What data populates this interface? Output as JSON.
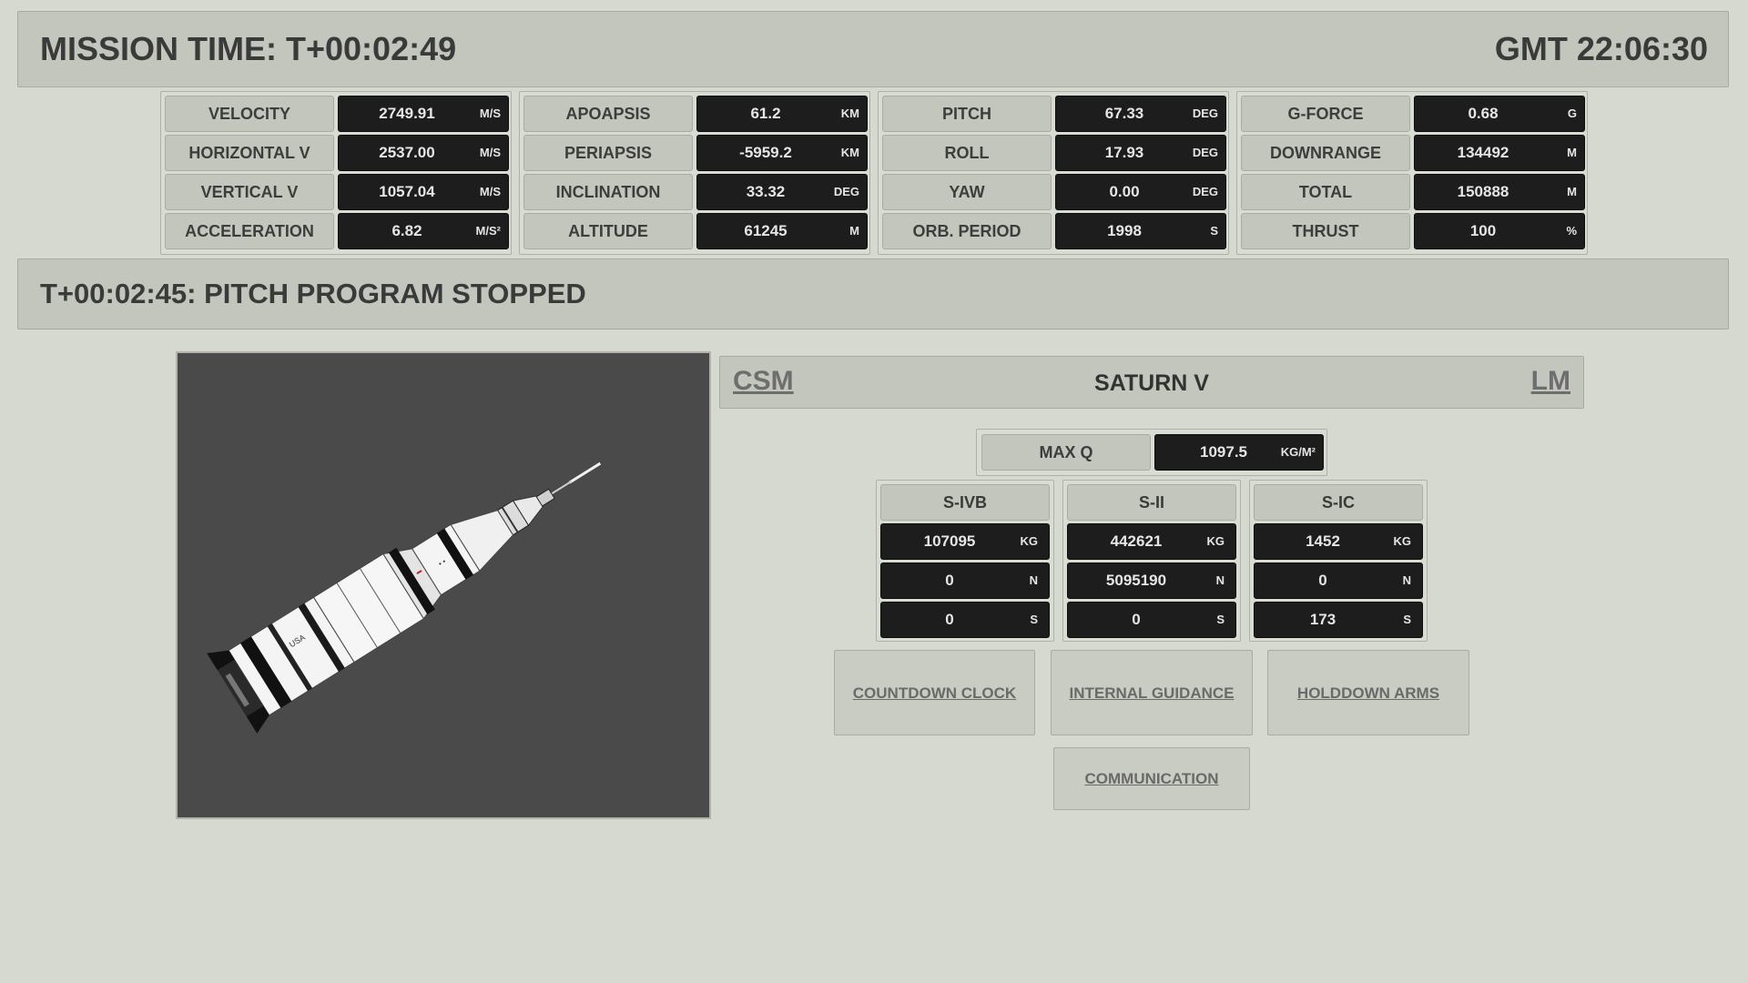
{
  "header": {
    "mission_time": "MISSION TIME: T+00:02:49",
    "gmt": "GMT 22:06:30"
  },
  "telemetry": [
    {
      "label": "VELOCITY",
      "value": "2749.91",
      "unit": "M/S"
    },
    {
      "label": "HORIZONTAL V",
      "value": "2537.00",
      "unit": "M/S"
    },
    {
      "label": "VERTICAL V",
      "value": "1057.04",
      "unit": "M/S"
    },
    {
      "label": "ACCELERATION",
      "value": "6.82",
      "unit": "M/S²"
    },
    {
      "label": "APOAPSIS",
      "value": "61.2",
      "unit": "KM"
    },
    {
      "label": "PERIAPSIS",
      "value": "-5959.2",
      "unit": "KM"
    },
    {
      "label": "INCLINATION",
      "value": "33.32",
      "unit": "DEG"
    },
    {
      "label": "ALTITUDE",
      "value": "61245",
      "unit": "M"
    },
    {
      "label": "PITCH",
      "value": "67.33",
      "unit": "DEG"
    },
    {
      "label": "ROLL",
      "value": "17.93",
      "unit": "DEG"
    },
    {
      "label": "YAW",
      "value": "0.00",
      "unit": "DEG"
    },
    {
      "label": "ORB. PERIOD",
      "value": "1998",
      "unit": "S"
    },
    {
      "label": "G-FORCE",
      "value": "0.68",
      "unit": "G"
    },
    {
      "label": "DOWNRANGE",
      "value": "134492",
      "unit": "M"
    },
    {
      "label": "TOTAL",
      "value": "150888",
      "unit": "M"
    },
    {
      "label": "THRUST",
      "value": "100",
      "unit": "%"
    }
  ],
  "event": {
    "text": "T+00:02:45: PITCH PROGRAM STOPPED"
  },
  "vehicle": {
    "csm_link": "CSM",
    "name": "SATURN V",
    "lm_link": "LM"
  },
  "max_q": {
    "label": "MAX Q",
    "value": "1097.5",
    "unit": "KG/M²"
  },
  "stages": [
    {
      "name": "S-IVB",
      "mass": "107095",
      "mass_unit": "KG",
      "thrust": "0",
      "thrust_unit": "N",
      "time": "0",
      "time_unit": "S"
    },
    {
      "name": "S-II",
      "mass": "442621",
      "mass_unit": "KG",
      "thrust": "5095190",
      "thrust_unit": "N",
      "time": "0",
      "time_unit": "S"
    },
    {
      "name": "S-IC",
      "mass": "1452",
      "mass_unit": "KG",
      "thrust": "0",
      "thrust_unit": "N",
      "time": "173",
      "time_unit": "S"
    }
  ],
  "buttons": {
    "countdown_clock": "COUNTDOWN CLOCK",
    "internal_guidance": "INTERNAL GUIDANCE",
    "holddown_arms": "HOLDDOWN ARMS",
    "communication": "COMMUNICATION"
  }
}
